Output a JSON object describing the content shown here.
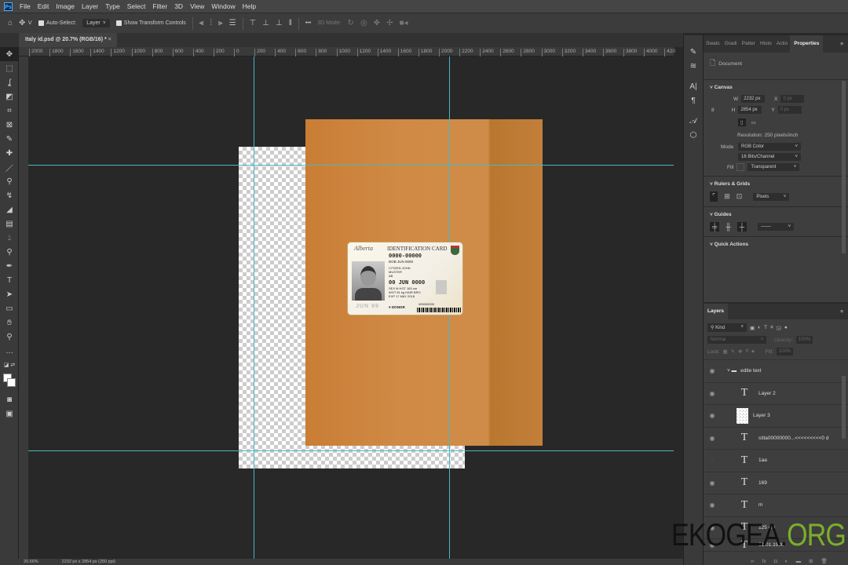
{
  "menubar": {
    "logo": "Ps",
    "items": [
      "File",
      "Edit",
      "Image",
      "Layer",
      "Type",
      "Select",
      "Filter",
      "3D",
      "View",
      "Window",
      "Help"
    ]
  },
  "options": {
    "auto_select": "Auto-Select:",
    "auto_select_value": "Layer",
    "show_transform": "Show Transform Controls",
    "more": "•••",
    "mode_3d": "3D Mode:"
  },
  "document_tab": {
    "title": "Italy id.psd @ 20.7% (RGB/16) *",
    "close": "×"
  },
  "ruler": {
    "top": [
      "2000",
      "1800",
      "1600",
      "1400",
      "1200",
      "1000",
      "800",
      "600",
      "400",
      "200",
      "0",
      "200",
      "400",
      "600",
      "800",
      "1000",
      "1200",
      "1400",
      "1600",
      "1800",
      "2000",
      "2200",
      "2400",
      "2600",
      "2800",
      "3000",
      "3200",
      "3400",
      "3600",
      "3800",
      "4000",
      "420"
    ]
  },
  "id_card": {
    "province": "Alberta",
    "title": "IDENTIFICATION CARD",
    "number": "0000-00000",
    "issue": "DOB JUN 0000",
    "name_lines": [
      "CITIZEN JOHN",
      "MUSTER",
      "AB"
    ],
    "dob": "00 JUN 0000",
    "detail_lines": [
      "SEX M HGT 183 cm",
      "WGT 81 kg HAIR BRO",
      "EXP 17 MAY 2018"
    ],
    "ghost_date": "JUN 99",
    "donor": "DONOR",
    "barcode_num": "000000000"
  },
  "status": {
    "zoom": "20.66%",
    "doc_size": "2232 px x 2854 px (250 ppi)"
  },
  "properties": {
    "tabs": [
      "Swatc",
      "Gradi",
      "Patter",
      "Histo",
      "Actio",
      "Properties"
    ],
    "document_label": "Document",
    "canvas_title": "Canvas",
    "w_label": "W",
    "w_value": "2232 px",
    "h_label": "H",
    "h_value": "2854 px",
    "x_label": "X",
    "x_value": "0 px",
    "y_label": "Y",
    "y_value": "0 px",
    "resolution": "Resolution: 250 pixels/inch",
    "mode_label": "Mode",
    "mode_value": "RGB Color",
    "depth_value": "16 Bits/Channel",
    "fill_label": "Fill",
    "fill_value": "Transparent",
    "rulers_title": "Rulers & Grids",
    "units_value": "Pixels",
    "guides_title": "Guides",
    "quick_actions_title": "Quick Actions"
  },
  "layers": {
    "title": "Layers",
    "filter": "Kind",
    "blend": "Normal",
    "opacity_label": "Opacity:",
    "opacity": "100%",
    "lock_label": "Lock:",
    "fill_label": "Fill:",
    "fill": "100%",
    "items": [
      {
        "name": "edite text",
        "type": "group"
      },
      {
        "name": "Layer 2",
        "type": "text"
      },
      {
        "name": "Layer 3",
        "type": "image"
      },
      {
        "name": "citta00000000...<<<<<<<<<0 d",
        "type": "text"
      },
      {
        "name": "1aa",
        "type": "text",
        "hidden": true
      },
      {
        "name": "169",
        "type": "text"
      },
      {
        "name": "m",
        "type": "text"
      },
      {
        "name": "125 cm",
        "type": "text"
      },
      {
        "name": "01.01.1990",
        "type": "text"
      }
    ]
  },
  "watermark": {
    "text1": "EKOGEA.",
    "text2": "ORG"
  }
}
